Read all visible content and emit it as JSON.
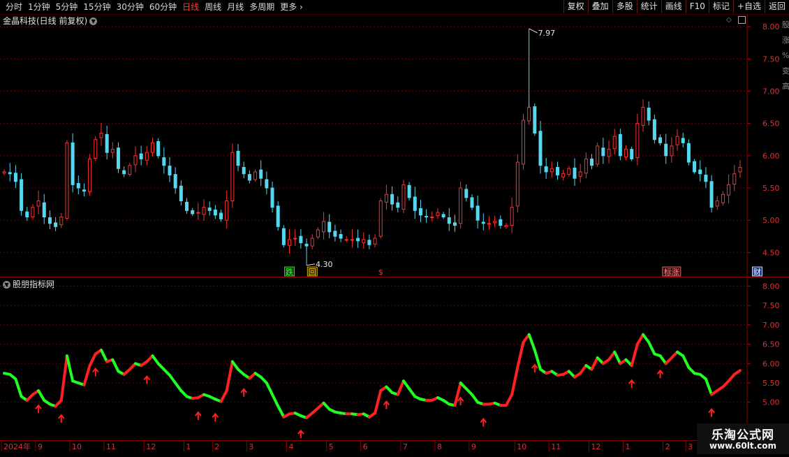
{
  "toolbar": {
    "periods": [
      "分时",
      "1分钟",
      "5分钟",
      "15分钟",
      "30分钟",
      "60分钟",
      "日线",
      "周线",
      "月线",
      "多周期",
      "更多 ›"
    ],
    "active_period": "日线",
    "tools": [
      "复权",
      "叠加",
      "多股",
      "统计",
      "画线",
      "F10",
      "标记",
      "+自选",
      "返回"
    ]
  },
  "main_panel": {
    "title": "金晶科技(日线 前复权)",
    "right_edge_labels": [
      "股",
      "涨",
      "%",
      "变",
      "高"
    ]
  },
  "sub_panel": {
    "title": "股朋指标网"
  },
  "watermark": {
    "line1": "乐淘公式网",
    "line2": "www.60lt.com"
  },
  "colors": {
    "up": "#ff3030",
    "down": "#54d8f0",
    "sub_up": "#ff2020",
    "sub_down": "#20ff20",
    "grid": "#6b0000",
    "axis_text": "#e03030"
  },
  "chart_data": [
    {
      "type": "candlestick",
      "ylim": [
        4.2,
        8.1
      ],
      "y_ticks": [
        4.5,
        5.0,
        5.5,
        6.0,
        6.5,
        7.0,
        7.5,
        8.0
      ],
      "y_tick_labels": [
        "4.50",
        "5.00",
        "5.50",
        "6.00",
        "6.50",
        "7.00",
        "7.50",
        "8.00"
      ],
      "close_series": [
        5.75,
        5.72,
        5.6,
        5.15,
        5.05,
        5.2,
        5.3,
        5.05,
        4.95,
        4.9,
        5.05,
        6.2,
        5.55,
        5.5,
        5.45,
        5.95,
        6.25,
        6.35,
        6.05,
        6.1,
        5.8,
        5.72,
        5.85,
        6.0,
        5.95,
        6.05,
        6.2,
        6.0,
        5.85,
        5.7,
        5.5,
        5.3,
        5.15,
        5.1,
        5.12,
        5.2,
        5.15,
        5.08,
        5.02,
        5.3,
        6.05,
        5.85,
        5.72,
        5.62,
        5.75,
        5.65,
        5.5,
        5.2,
        4.9,
        4.62,
        4.7,
        4.72,
        4.65,
        4.6,
        4.72,
        4.85,
        4.98,
        4.82,
        4.75,
        4.72,
        4.7,
        4.7,
        4.68,
        4.7,
        4.62,
        4.72,
        5.3,
        5.4,
        5.25,
        5.2,
        5.55,
        5.35,
        5.15,
        5.08,
        5.05,
        5.05,
        5.12,
        5.05,
        4.95,
        4.92,
        5.5,
        5.35,
        5.2,
        5.0,
        4.95,
        4.95,
        4.98,
        4.92,
        4.92,
        5.2,
        5.9,
        6.55,
        6.75,
        6.35,
        5.85,
        5.75,
        5.8,
        5.7,
        5.72,
        5.8,
        5.65,
        5.75,
        5.95,
        5.85,
        6.15,
        6.0,
        6.1,
        6.3,
        6.0,
        6.1,
        5.95,
        6.5,
        6.75,
        6.55,
        6.25,
        6.2,
        6.0,
        6.15,
        6.3,
        6.2,
        5.9,
        5.75,
        5.72,
        5.6,
        5.2,
        5.3,
        5.4,
        5.55,
        5.72,
        5.82
      ],
      "labels": [
        {
          "value": 7.97,
          "text": "7.97",
          "kind": "high"
        },
        {
          "value": 4.3,
          "text": "4.30",
          "kind": "low"
        }
      ],
      "markers": [
        {
          "index": 50,
          "text": "跌",
          "color": "#30ff30",
          "bg": "#1a3a1a"
        },
        {
          "index": 54,
          "text": "回",
          "color": "#ffcc00",
          "bg": "#3a2a00"
        },
        {
          "index": 66,
          "text": "$",
          "color": "#ff3030",
          "bg": ""
        },
        {
          "index": 117,
          "text": "标涨",
          "color": "#ff8080",
          "bg": "#3a1010"
        },
        {
          "index": 132,
          "text": "财",
          "color": "#ffffff",
          "bg": "#1a3a8a"
        }
      ]
    },
    {
      "type": "line",
      "ylim": [
        4.2,
        8.1
      ],
      "y_ticks": [
        5.0,
        5.5,
        6.0,
        6.5,
        7.0,
        7.5,
        8.0
      ],
      "y_tick_labels": [
        "5.00",
        "5.50",
        "6.00",
        "6.50",
        "7.00",
        "7.50",
        "8.00"
      ],
      "up_arrow_indices": [
        6,
        10,
        16,
        25,
        34,
        37,
        42,
        52,
        67,
        80,
        84,
        93,
        110,
        115,
        124,
        130
      ],
      "x_axis_labels": [
        {
          "index": 0,
          "text": "2024年"
        },
        {
          "index": 6,
          "text": "9"
        },
        {
          "index": 12,
          "text": "10"
        },
        {
          "index": 18,
          "text": "11"
        },
        {
          "index": 25,
          "text": "12"
        },
        {
          "index": 32,
          "text": "1"
        },
        {
          "index": 37,
          "text": "2"
        },
        {
          "index": 43,
          "text": "3"
        },
        {
          "index": 50,
          "text": "4"
        },
        {
          "index": 57,
          "text": "5"
        },
        {
          "index": 63,
          "text": "6"
        },
        {
          "index": 70,
          "text": "7"
        },
        {
          "index": 76,
          "text": "8"
        },
        {
          "index": 82,
          "text": "9"
        },
        {
          "index": 90,
          "text": "10"
        },
        {
          "index": 96,
          "text": "11"
        },
        {
          "index": 103,
          "text": "12"
        },
        {
          "index": 109,
          "text": "1"
        },
        {
          "index": 116,
          "text": "2"
        },
        {
          "index": 120,
          "text": "3"
        }
      ]
    }
  ]
}
